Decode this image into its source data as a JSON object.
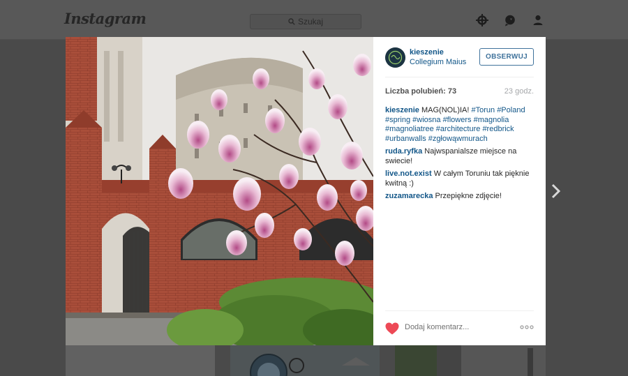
{
  "app": {
    "logo": "Instagram",
    "search_placeholder": "Szukaj"
  },
  "post": {
    "username": "kieszenie",
    "location": "Collegium Maius",
    "follow_label": "OBSERWUJ",
    "likes": "Liczba polubień: 73",
    "time": "23 godz.",
    "caption": {
      "user": "kieszenie",
      "text": " MAG(NOL)IA! ",
      "tags": [
        "#Torun",
        "#Poland",
        "#spring",
        "#wiosna",
        "#flowers",
        "#magnolia",
        "#magnoliatree",
        "#architecture",
        "#redbrick",
        "#urbanwalls",
        "#zgłowąwmurach"
      ]
    },
    "comments": [
      {
        "user": "ruda.ryfka",
        "text": " Najwspanialsze miejsce na swiecie!"
      },
      {
        "user": "live.not.exist",
        "text": " W całym Toruniu tak pięknie kwitną :)"
      },
      {
        "user": "zuzamarecka",
        "text": " Przepiękne zdjęcie!"
      }
    ],
    "add_comment_placeholder": "Dodaj komentarz...",
    "liked": true
  },
  "colors": {
    "link": "#125688",
    "heart": "#ed4956",
    "follow": "#3f729b"
  },
  "icons": [
    "search-icon",
    "explore-icon",
    "activity-icon",
    "profile-icon",
    "heart-icon",
    "more-options-icon",
    "next-arrow-icon"
  ]
}
